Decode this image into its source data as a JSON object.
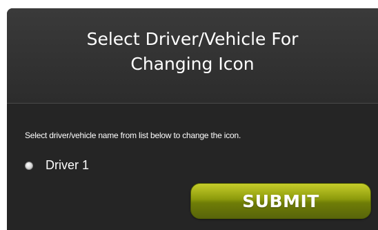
{
  "dialog": {
    "title_line1": "Select Driver/Vehicle For",
    "title_line2": "Changing Icon",
    "instruction": "Select driver/vehicle name from list below to change the icon.",
    "options": [
      {
        "label": "Driver 1",
        "selected": false
      }
    ],
    "submit_label": "SUBMIT"
  },
  "colors": {
    "panel_bg": "#2a2a2a",
    "button_accent": "#8c9a0c",
    "text": "#ffffff"
  }
}
